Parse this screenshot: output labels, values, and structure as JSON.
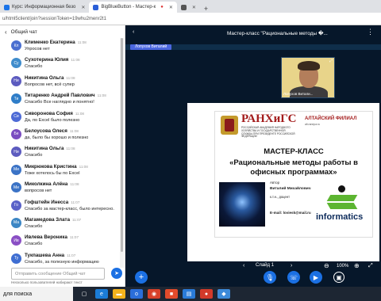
{
  "browser": {
    "tabs": [
      {
        "label": "Курс: Информационная безо",
        "active": false
      },
      {
        "label": "BigBlueButton - Мастер-к",
        "active": true
      },
      {
        "label": "",
        "active": false
      }
    ],
    "new_tab": "+",
    "address": "u/html5client/join?sessionToken=19whu2menr2t1"
  },
  "chat": {
    "header": "Общий чат",
    "messages": [
      {
        "initials": "Кл",
        "color": "#4a6fd0",
        "name": "Клименко Екатерина",
        "time": "11:08",
        "text": "Упросов нет"
      },
      {
        "initials": "Су",
        "color": "#3f8ccc",
        "name": "Сухотерина Юлия",
        "time": "11:08",
        "text": "Спасибо"
      },
      {
        "initials": "Ни",
        "color": "#5c5bbf",
        "name": "Никитина Ольга",
        "time": "11:08",
        "text": "Вопросов нет, всё супер"
      },
      {
        "initials": "Ти",
        "color": "#2f7dc8",
        "name": "Титаренко Андрей Павлович",
        "time": "11:08",
        "text": "Спасибо  Все наглядно и понятно!"
      },
      {
        "initials": "Си",
        "color": "#4e6bd6",
        "name": "Сиворонова София",
        "time": "11:08",
        "text": "Да, по Excel было полезно"
      },
      {
        "initials": "Бе",
        "color": "#7a4cc0",
        "name": "Белоусова Олеся",
        "time": "11:08",
        "text": "да, было бы хорошо и полезно"
      },
      {
        "initials": "Ни",
        "color": "#5c5bbf",
        "name": "Никитина Ольга",
        "time": "11:08",
        "text": "Спасибо"
      },
      {
        "initials": "Ми",
        "color": "#3b73c6",
        "name": "Микрюкова Кристина",
        "time": "11:08",
        "text": "Тоже хотелось бы по Excel"
      },
      {
        "initials": "Ми",
        "color": "#3b73c6",
        "name": "Миколкина Алёна",
        "time": "11:08",
        "text": "вопросов нет"
      },
      {
        "initials": "Го",
        "color": "#5a62c8",
        "name": "Гофштейн Инесса",
        "time": "11:07",
        "text": "Спасибо за мастер-класс, было интересно."
      },
      {
        "initials": "Ма",
        "color": "#3c86c4",
        "name": "Магамедова Злата",
        "time": "11:07",
        "text": "Спасибо"
      },
      {
        "initials": "Ив",
        "color": "#8a4fc4",
        "name": "Ивлева Вероника",
        "time": "11:07",
        "text": "Спасибо"
      },
      {
        "initials": "Ту",
        "color": "#3f6ed2",
        "name": "Тукпашева Анна",
        "time": "11:07",
        "text": "Спасибо, за полезную информацию"
      }
    ],
    "input_placeholder": "Отправить сообщение Общий чат",
    "typing": "Несколько пользователей набирают текст"
  },
  "meeting": {
    "title": "Мастер-класс \"Рациональные методы �...",
    "presenter_label": "Лопухов Виталий",
    "cam_label": "Лопухов Витали...",
    "slide": {
      "brand": "РАНХиГС",
      "brand_sub": "РОССИЙСКАЯ АКАДЕМИЯ НАРОДНОГО ХОЗЯЙСТВА И ГОСУДАРСТВЕННОЙ СЛУЖБЫ ПРИ ПРЕЗИДЕНТЕ РОССИЙСКОЙ ФЕДЕРАЦИИ",
      "branch": "АЛТАЙСКИЙ ФИЛИАЛ",
      "branch_url": "alt.ranepa.ru",
      "heading1": "МАСТЕР-КЛАСС",
      "heading2": "«Рациональные методы работы в офисных программах»",
      "author_label": "Автор",
      "author_name": "Виталий Михайлович",
      "author_degree": "к.т.н., доцент",
      "email": "E-mail: loviesk@mail.ru",
      "logo_text": "informatics"
    },
    "slide_selector": "Слайд 1",
    "zoom": "100%"
  },
  "taskbar": {
    "search_placeholder": "для поиска"
  }
}
